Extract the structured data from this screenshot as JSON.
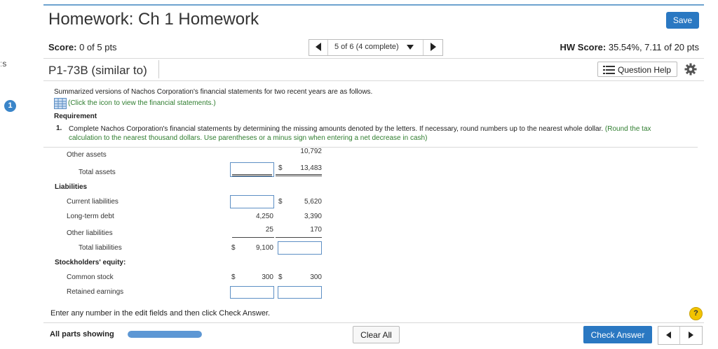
{
  "left_edge": {
    "text": "ːs",
    "question_badge": "1"
  },
  "header": {
    "title": "Homework: Ch 1 Homework",
    "save_label": "Save",
    "score_label": "Score:",
    "score_value": " 0 of 5 pts",
    "nav_label": "5 of 6 (4 complete)",
    "hw_score_label": "HW Score:",
    "hw_score_value": " 35.54%, 7.11 of 20 pts"
  },
  "problem": {
    "title": "P1-73B (similar to)",
    "question_help_label": "Question Help"
  },
  "content": {
    "intro": "Summarized versions of Nachos Corporation's financial statements for two recent years are as follows.",
    "statements_link": "(Click the icon to view the financial statements.)",
    "requirement_heading": "Requirement",
    "requirement_number": "1.",
    "requirement_text": "Complete Nachos Corporation's financial statements by determining the missing amounts denoted by the letters. If necessary, round numbers up to the nearest whole dollar.",
    "requirement_note": "(Round the tax calculation to the nearest thousand dollars. Use parentheses or a minus sign when entering a net decrease in cash)"
  },
  "table": {
    "other_assets": {
      "label": "Other assets",
      "col2": "10,792"
    },
    "total_assets": {
      "label": "Total assets",
      "dollar2": "$",
      "col2": "13,483"
    },
    "liabilities_heading": "Liabilities",
    "current_liabilities": {
      "label": "Current liabilities",
      "dollar2": "$",
      "col2": "5,620"
    },
    "long_term_debt": {
      "label": "Long-term debt",
      "col1": "4,250",
      "col2": "3,390"
    },
    "other_liabilities": {
      "label": "Other liabilities",
      "col1": "25",
      "col2": "170"
    },
    "total_liabilities": {
      "label": "Total liabilities",
      "dollar1": "$",
      "col1": "9,100"
    },
    "equity_heading": "Stockholders' equity:",
    "common_stock": {
      "label": "Common stock",
      "dollar1": "$",
      "col1": "300",
      "dollar2": "$",
      "col2": "300"
    },
    "retained_earnings": {
      "label": "Retained earnings"
    }
  },
  "footer": {
    "message": "Enter any number in the edit fields and then click Check Answer.",
    "help_icon": "?",
    "parts_label": "All parts showing",
    "progress_fraction": 1.0,
    "clear_all_label": "Clear All",
    "check_answer_label": "Check Answer"
  },
  "colors": {
    "accent": "#2a78c2",
    "link_green": "#2f7d2f",
    "input_border": "#5d8fc4"
  }
}
